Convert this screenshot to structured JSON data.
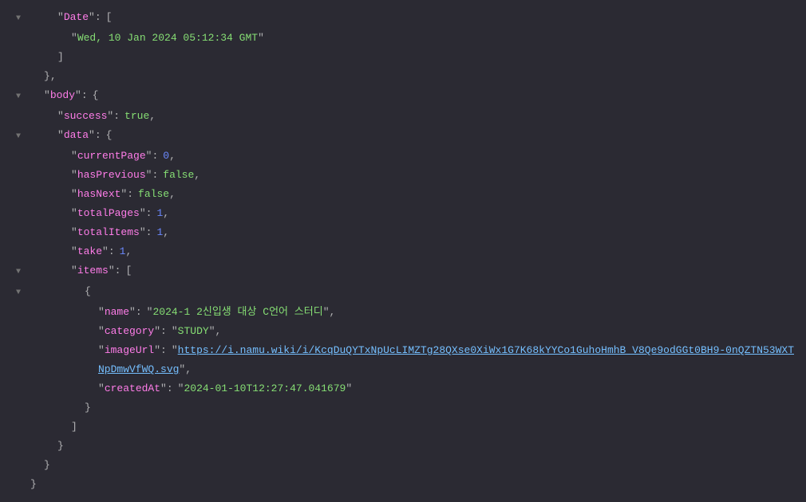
{
  "gutter": {
    "arrow": "▼"
  },
  "json": {
    "date_key": "Date",
    "date_value": "Wed, 10 Jan 2024 05:12:34 GMT",
    "body_key": "body",
    "success_key": "success",
    "success_value": "true",
    "data_key": "data",
    "currentPage_key": "currentPage",
    "currentPage_value": "0",
    "hasPrevious_key": "hasPrevious",
    "hasPrevious_value": "false",
    "hasNext_key": "hasNext",
    "hasNext_value": "false",
    "totalPages_key": "totalPages",
    "totalPages_value": "1",
    "totalItems_key": "totalItems",
    "totalItems_value": "1",
    "take_key": "take",
    "take_value": "1",
    "items_key": "items",
    "name_key": "name",
    "name_value": "2024-1 2신입생 대상 C언어 스터디",
    "category_key": "category",
    "category_value": "STUDY",
    "imageUrl_key": "imageUrl",
    "imageUrl_value": "https://i.namu.wiki/i/KcqDuQYTxNpUcLIMZTg28QXse0XiWx1G7K68kYYCo1GuhoHmhB_V8Qe9odGGt0BH9-0nQZTN53WXTNpDmwVfWQ.svg",
    "createdAt_key": "createdAt",
    "createdAt_value": "2024-01-10T12:27:47.041679"
  },
  "punct": {
    "open_bracket": "[",
    "close_bracket": "]",
    "open_brace": "{",
    "close_brace": "}",
    "comma": ",",
    "colon": ":",
    "quote": "\""
  }
}
